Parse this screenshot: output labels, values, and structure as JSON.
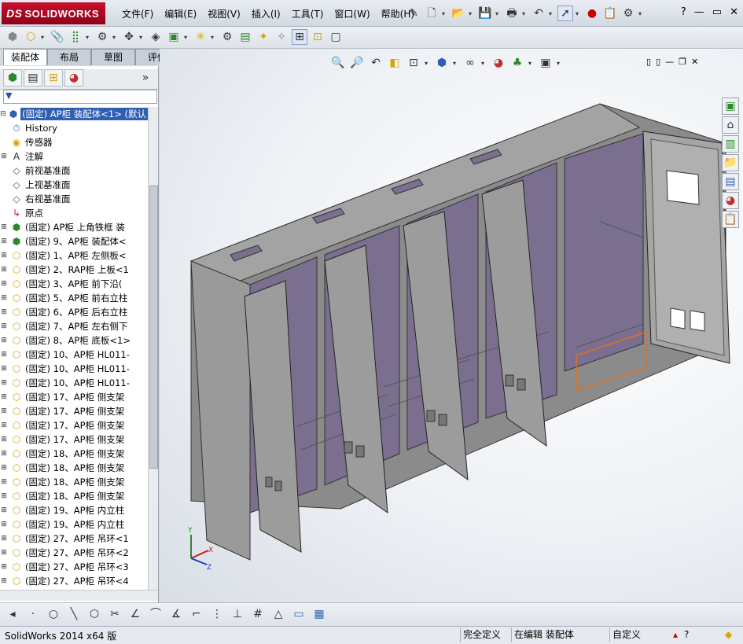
{
  "app": {
    "logo_text": "SOLIDWORKS",
    "logo_prefix": "DS"
  },
  "menu": [
    "文件(F)",
    "编辑(E)",
    "视图(V)",
    "插入(I)",
    "工具(T)",
    "窗口(W)",
    "帮助(H)"
  ],
  "window_controls": [
    "?",
    "—",
    "▭",
    "✕"
  ],
  "tabs": [
    "装配体",
    "布局",
    "草图",
    "评估"
  ],
  "filter_icon": "funnel-icon",
  "tree": {
    "root": "(固定) AP柜 装配体<1> (默认",
    "items": [
      {
        "label": "History",
        "icon": "history-icon"
      },
      {
        "label": "传感器",
        "icon": "sensor-icon"
      },
      {
        "label": "注解",
        "icon": "annotation-icon",
        "exp": "+"
      },
      {
        "label": "前视基准面",
        "icon": "plane-icon"
      },
      {
        "label": "上视基准面",
        "icon": "plane-icon"
      },
      {
        "label": "右视基准面",
        "icon": "plane-icon"
      },
      {
        "label": "原点",
        "icon": "origin-icon"
      },
      {
        "label": "(固定) AP柜 上角铁框 装",
        "icon": "assembly-icon",
        "exp": "+"
      },
      {
        "label": "(固定) 9、AP柜 装配体<",
        "icon": "assembly-icon",
        "exp": "+"
      },
      {
        "label": "(固定) 1、AP柜 左侧板<",
        "icon": "part-icon",
        "exp": "+"
      },
      {
        "label": "(固定) 2、RAP柜 上板<1",
        "icon": "part-icon",
        "exp": "+"
      },
      {
        "label": "(固定) 3、AP柜 前下沿(",
        "icon": "part-icon",
        "exp": "+"
      },
      {
        "label": "(固定) 5、AP柜 前右立柱",
        "icon": "part-icon",
        "exp": "+"
      },
      {
        "label": "(固定) 6、AP柜 后右立柱",
        "icon": "part-icon",
        "exp": "+"
      },
      {
        "label": "(固定) 7、AP柜 左右侧下",
        "icon": "part-icon",
        "exp": "+"
      },
      {
        "label": "(固定) 8、AP柜 底板<1>",
        "icon": "part-icon",
        "exp": "+"
      },
      {
        "label": "(固定) 10、AP柜 HL011-",
        "icon": "part-icon",
        "exp": "+"
      },
      {
        "label": "(固定) 10、AP柜 HL011-",
        "icon": "part-icon",
        "exp": "+"
      },
      {
        "label": "(固定) 10、AP柜 HL011-",
        "icon": "part-icon",
        "exp": "+"
      },
      {
        "label": "(固定) 17、AP柜 侧支架",
        "icon": "part-icon",
        "exp": "+"
      },
      {
        "label": "(固定) 17、AP柜 侧支架",
        "icon": "part-icon",
        "exp": "+"
      },
      {
        "label": "(固定) 17、AP柜 侧支架",
        "icon": "part-icon",
        "exp": "+"
      },
      {
        "label": "(固定) 17、AP柜 侧支架",
        "icon": "part-icon",
        "exp": "+"
      },
      {
        "label": "(固定) 18、AP柜 侧支架",
        "icon": "part-icon",
        "exp": "+"
      },
      {
        "label": "(固定) 18、AP柜 侧支架",
        "icon": "part-icon",
        "exp": "+"
      },
      {
        "label": "(固定) 18、AP柜 侧支架",
        "icon": "part-icon",
        "exp": "+"
      },
      {
        "label": "(固定) 18、AP柜 侧支架",
        "icon": "part-icon",
        "exp": "+"
      },
      {
        "label": "(固定) 19、AP柜 内立柱",
        "icon": "part-icon",
        "exp": "+"
      },
      {
        "label": "(固定) 19、AP柜 内立柱",
        "icon": "part-icon",
        "exp": "+"
      },
      {
        "label": "(固定) 27、AP柜 吊环<1",
        "icon": "part-icon",
        "exp": "+"
      },
      {
        "label": "(固定) 27、AP柜 吊环<2",
        "icon": "part-icon",
        "exp": "+"
      },
      {
        "label": "(固定) 27、AP柜 吊环<3",
        "icon": "part-icon",
        "exp": "+"
      },
      {
        "label": "(固定) 27、AP柜 吊环<4",
        "icon": "part-icon",
        "exp": "+"
      }
    ]
  },
  "triad": {
    "x": "X",
    "y": "Y",
    "z": "Z"
  },
  "status": {
    "app_version": "SolidWorks 2014 x64 版",
    "definition": "完全定义",
    "mode": "在编辑 装配体",
    "units": "自定义"
  },
  "colors": {
    "accent": "#2f5fb3",
    "cabinet": "#8a8a8a",
    "interior": "#7b6f8f",
    "door": "#9a9a9a",
    "highlight": "#e07020"
  }
}
